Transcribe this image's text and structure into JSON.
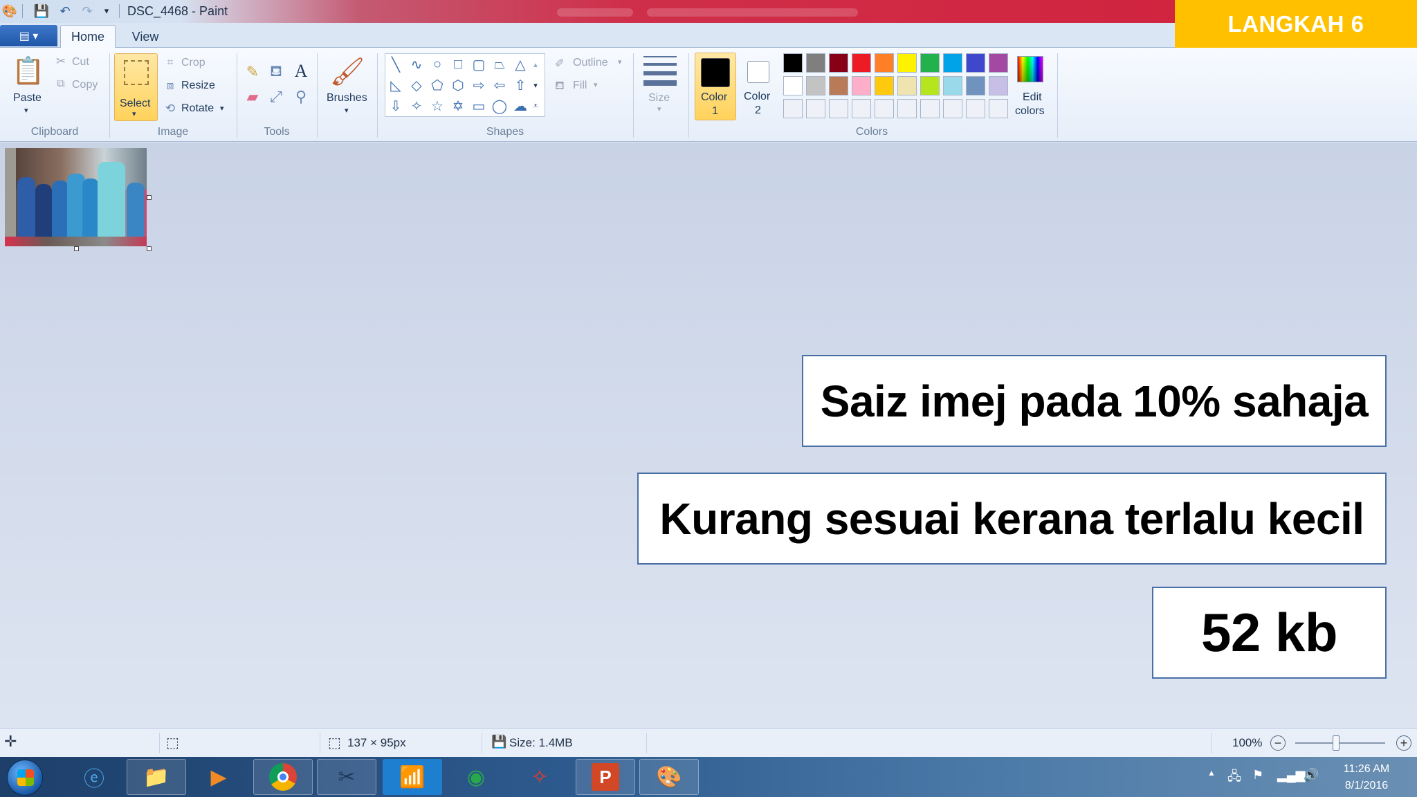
{
  "window": {
    "title": "DSC_4468 - Paint",
    "step_badge": "LANGKAH 6"
  },
  "tabs": {
    "home": "Home",
    "view": "View"
  },
  "ribbon": {
    "clipboard": {
      "label": "Clipboard",
      "paste": "Paste",
      "cut": "Cut",
      "copy": "Copy"
    },
    "image": {
      "label": "Image",
      "select": "Select",
      "crop": "Crop",
      "resize": "Resize",
      "rotate": "Rotate"
    },
    "tools": {
      "label": "Tools"
    },
    "brushes": {
      "label": "Brushes"
    },
    "shapes": {
      "label": "Shapes",
      "outline": "Outline",
      "fill": "Fill"
    },
    "size": {
      "label": "Size"
    },
    "colors": {
      "label": "Colors",
      "color1_line1": "Color",
      "color1_line2": "1",
      "color2_line1": "Color",
      "color2_line2": "2",
      "edit_line1": "Edit",
      "edit_line2": "colors",
      "color1_value": "#000000",
      "color2_value": "#ffffff",
      "palette_row1": [
        "#000000",
        "#7f7f7f",
        "#880015",
        "#ed1c24",
        "#ff7f27",
        "#fff200",
        "#22b14c",
        "#00a2e8",
        "#3f48cc",
        "#a349a4"
      ],
      "palette_row2": [
        "#ffffff",
        "#c3c3c3",
        "#b97a57",
        "#ffaec9",
        "#ffc90e",
        "#efe4b0",
        "#b5e61d",
        "#99d9ea",
        "#7092be",
        "#c8bfe7"
      ]
    }
  },
  "callouts": {
    "line1": "Saiz imej pada 10% sahaja",
    "line2": "Kurang sesuai kerana terlalu kecil",
    "line3": "52 kb"
  },
  "status": {
    "dimensions": "137 × 95px",
    "size": "Size: 1.4MB",
    "zoom": "100%",
    "zoom_level_percent": 45
  },
  "taskbar": {
    "time": "11:26 AM",
    "date": "8/1/2016"
  }
}
